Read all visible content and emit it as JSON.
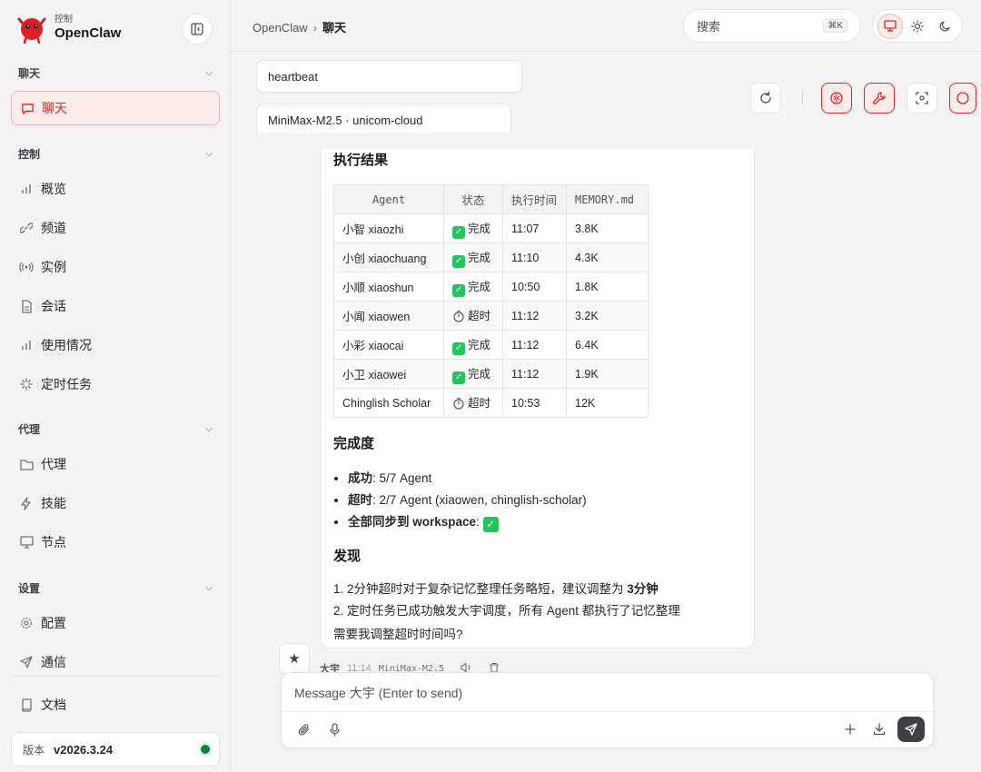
{
  "brand": {
    "sub": "控制",
    "name": "OpenClaw"
  },
  "sidebar": {
    "groups": [
      {
        "title": "聊天",
        "items": [
          {
            "label": "聊天",
            "icon": "message-icon",
            "active": true
          }
        ]
      },
      {
        "title": "控制",
        "items": [
          {
            "label": "概览",
            "icon": "bar-chart-icon"
          },
          {
            "label": "频道",
            "icon": "link-icon"
          },
          {
            "label": "实例",
            "icon": "broadcast-icon"
          },
          {
            "label": "会话",
            "icon": "file-icon"
          },
          {
            "label": "使用情况",
            "icon": "bar-chart-icon"
          },
          {
            "label": "定时任务",
            "icon": "loader-icon"
          }
        ]
      },
      {
        "title": "代理",
        "items": [
          {
            "label": "代理",
            "icon": "folder-icon"
          },
          {
            "label": "技能",
            "icon": "zap-icon"
          },
          {
            "label": "节点",
            "icon": "monitor-icon"
          }
        ]
      },
      {
        "title": "设置",
        "items": [
          {
            "label": "配置",
            "icon": "gear-icon"
          },
          {
            "label": "通信",
            "icon": "send-icon"
          }
        ]
      }
    ],
    "docs": "文档",
    "version_label": "版本",
    "version_value": "v2026.3.24"
  },
  "topbar": {
    "breadcrumb_root": "OpenClaw",
    "breadcrumb_sep": "›",
    "breadcrumb_current": "聊天",
    "search_placeholder": "搜索",
    "search_kbd": "⌘K"
  },
  "chips": {
    "session": "heartbeat",
    "model": "MiniMax-M2.5 · unicom-cloud"
  },
  "message": {
    "result_heading": "执行结果",
    "table": {
      "headers": [
        "Agent",
        "状态",
        "执行时间",
        "MEMORY.md"
      ],
      "rows": [
        {
          "agent": "小智 xiaozhi",
          "status": "完成",
          "ok": true,
          "time": "11:07",
          "size": "3.8K"
        },
        {
          "agent": "小创 xiaochuang",
          "status": "完成",
          "ok": true,
          "time": "11:10",
          "size": "4.3K"
        },
        {
          "agent": "小顺 xiaoshun",
          "status": "完成",
          "ok": true,
          "time": "10:50",
          "size": "1.8K"
        },
        {
          "agent": "小闻 xiaowen",
          "status": "超时",
          "ok": false,
          "time": "11:12",
          "size": "3.2K"
        },
        {
          "agent": "小彩 xiaocai",
          "status": "完成",
          "ok": true,
          "time": "11:12",
          "size": "6.4K"
        },
        {
          "agent": "小卫 xiaowei",
          "status": "完成",
          "ok": true,
          "time": "11:12",
          "size": "1.9K"
        },
        {
          "agent": "Chinglish Scholar",
          "status": "超时",
          "ok": false,
          "time": "10:53",
          "size": "12K"
        }
      ]
    },
    "completion_heading": "完成度",
    "bullets": [
      {
        "bold": "成功",
        "rest": ": 5/7 Agent"
      },
      {
        "bold": "超时",
        "rest": ": 2/7 Agent (xiaowen, chinglish-scholar)"
      },
      {
        "bold": "全部同步到 workspace",
        "rest": ": "
      }
    ],
    "findings_heading": "发现",
    "finding1_text": "1. 2分钟超时对于复杂记忆整理任务略短，建议调整为 ",
    "finding1_bold": "3分钟",
    "finding2_text": "2. 定时任务已成功触发大宇调度，所有 Agent 都执行了记忆整理",
    "question": "需要我调整超时时间吗?",
    "sender": "大宇",
    "time": "11:14",
    "model": "MiniMax-M2.5"
  },
  "composer": {
    "placeholder": "Message 大宇 (Enter to send)"
  }
}
